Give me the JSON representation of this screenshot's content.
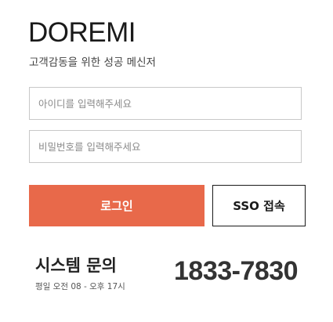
{
  "brand": {
    "logo": "DOREMI",
    "tagline": "고객감동을 위한 성공 메신저"
  },
  "login_form": {
    "id_placeholder": "아이디를 입력해주세요",
    "id_value": "",
    "password_placeholder": "비밀번호를 입력해주세요",
    "password_value": "",
    "login_button": "로그인",
    "sso_button": "SSO 접속"
  },
  "support": {
    "title": "시스템 문의",
    "hours": "평일 오전 08 - 오후 17시",
    "phone": "1833-7830"
  },
  "colors": {
    "accent": "#e8694a",
    "text": "#222222",
    "border": "#c8c8c8"
  }
}
